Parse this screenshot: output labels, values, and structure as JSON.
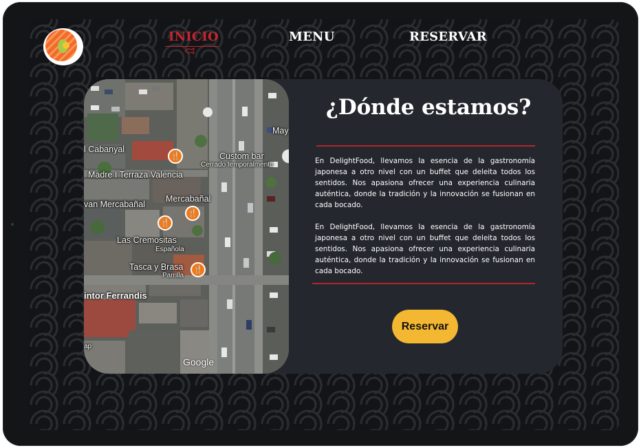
{
  "nav": {
    "links": [
      {
        "label": "INICIO",
        "active": true
      },
      {
        "label": "MENU",
        "active": false
      },
      {
        "label": "RESERVAR",
        "active": false
      }
    ],
    "active_color": "#c1272d"
  },
  "section": {
    "title": "¿Dónde estamos?",
    "paragraphs": [
      "En DelightFood, llevamos la esencia de la gastronomía japonesa a otro nivel con un buffet que deleita todos los sentidos. Nos apasiona ofrecer una experiencia culinaria auténtica, donde la tradición y la innovación se fusionan en cada bocado.",
      "En DelightFood, llevamos la esencia de la gastronomía japonesa a otro nivel con un buffet que deleita todos los sentidos. Nos apasiona ofrecer una experiencia culinaria auténtica, donde la tradición y la innovación se fusionan en cada bocado."
    ],
    "button_label": "Reservar",
    "accent_color": "#b3262b",
    "button_color": "#f4b731"
  },
  "map": {
    "labels": {
      "cabanyal": "l Cabanyal",
      "madre": "Madre I Terraza Valencia",
      "custom_bar": "Custom bar",
      "cerrado": "Cerrado temporalmente",
      "mercabanal_left": "van Mercabañal",
      "mercabanal": "Mercabañal",
      "cremositas": "Las Cremositas",
      "espanola": "Española",
      "tasca": "Tasca y Brasa",
      "parrilla": "Parrilla",
      "pintor": "intor Ferrandis",
      "may": "May",
      "rap": "ap",
      "attribution": "Google"
    },
    "pin_icon": "restaurant-icon"
  }
}
